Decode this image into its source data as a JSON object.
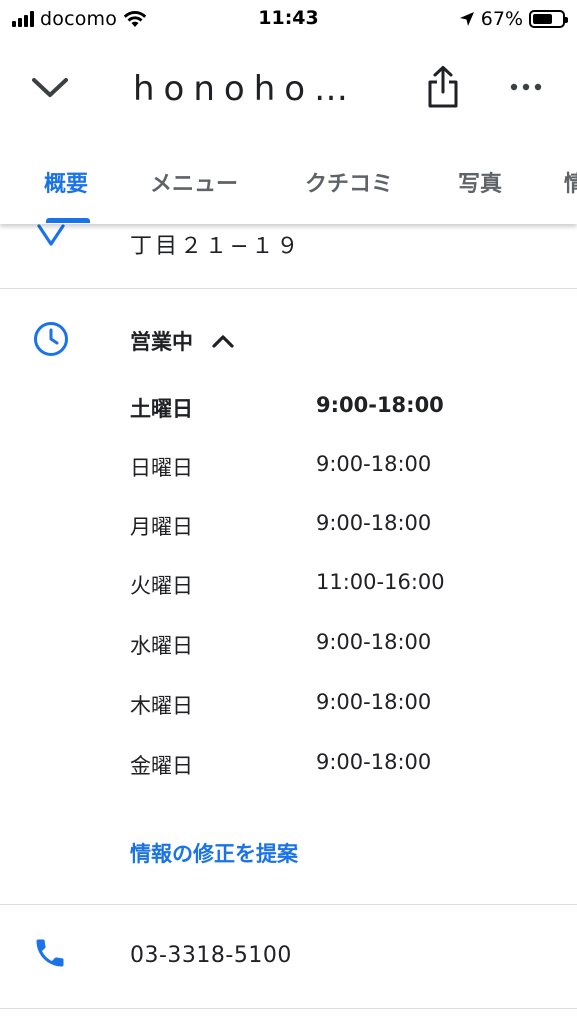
{
  "status_bar": {
    "carrier": "docomo",
    "time": "11:43",
    "battery_percent_label": "67%",
    "battery_level": 0.67
  },
  "header": {
    "title": "honoho…"
  },
  "tabs": [
    {
      "label": "概要",
      "active": true
    },
    {
      "label": "メニュー"
    },
    {
      "label": "クチコミ"
    },
    {
      "label": "写真"
    },
    {
      "label": "情"
    }
  ],
  "address": {
    "line": "丁目２１−１９"
  },
  "hours": {
    "status": "営業中",
    "rows": [
      {
        "day": "土曜日",
        "time": "9:00-18:00",
        "today": true
      },
      {
        "day": "日曜日",
        "time": "9:00-18:00"
      },
      {
        "day": "月曜日",
        "time": "9:00-18:00"
      },
      {
        "day": "火曜日",
        "time": "11:00-16:00"
      },
      {
        "day": "水曜日",
        "time": "9:00-18:00"
      },
      {
        "day": "木曜日",
        "time": "9:00-18:00"
      },
      {
        "day": "金曜日",
        "time": "9:00-18:00"
      }
    ],
    "suggest_edit": "情報の修正を提案"
  },
  "phone": {
    "number": "03-3318-5100"
  },
  "colors": {
    "accent": "#1a73e8",
    "text": "#202124",
    "tab_inactive": "#5f6368",
    "divider": "#dadce0"
  },
  "icons": {
    "collapse": "chevron-down-icon",
    "share": "share-icon",
    "more": "more-horizontal-icon",
    "location": "location-pin-icon",
    "hours": "clock-icon",
    "expand_hours": "chevron-up-icon",
    "phone": "phone-icon"
  }
}
